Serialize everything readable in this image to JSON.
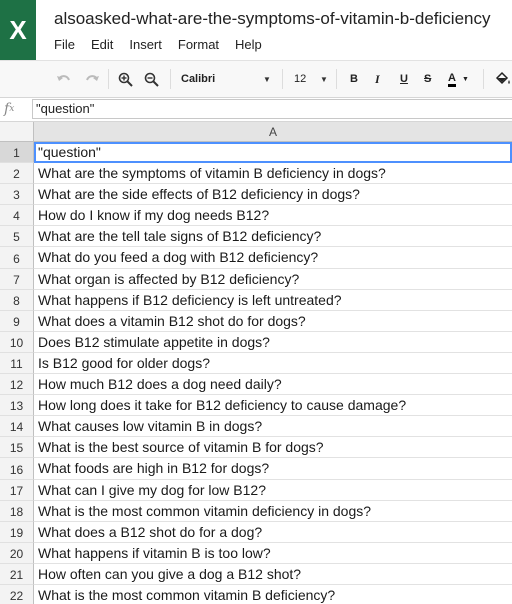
{
  "app": {
    "logo_letter": "X",
    "title": "alsoasked-what-are-the-symptoms-of-vitamin-b-deficiency",
    "accent": "#1e7145"
  },
  "menu": [
    "File",
    "Edit",
    "Insert",
    "Format",
    "Help"
  ],
  "toolbar": {
    "undo_icon": "undo-icon",
    "redo_icon": "redo-icon",
    "zoom_in_icon": "zoom-in-icon",
    "zoom_out_icon": "zoom-out-icon",
    "font_name": "Calibri",
    "font_size": "12",
    "bold": "B",
    "italic": "I",
    "underline": "U",
    "strikethrough": "S",
    "text_color": "A",
    "fill_icon": "paint-bucket-icon"
  },
  "formula_bar": {
    "label": "fx",
    "value": "\"question\""
  },
  "sheet": {
    "column_header": "A",
    "row_numbers": [
      "1",
      "2",
      "3",
      "4",
      "5",
      "6",
      "7",
      "8",
      "9",
      "10",
      "11",
      "12",
      "13",
      "14",
      "15",
      "16",
      "17",
      "18",
      "19",
      "20",
      "21",
      "22"
    ],
    "cells": [
      "\"question\"",
      "What are the symptoms of vitamin B deficiency in dogs?",
      "What are the side effects of B12 deficiency in dogs?",
      "How do I know if my dog needs B12?",
      "What are the tell tale signs of B12 deficiency?",
      "What do you feed a dog with B12 deficiency?",
      "What organ is affected by B12 deficiency?",
      "What happens if B12 deficiency is left untreated?",
      "What does a vitamin B12 shot do for dogs?",
      "Does B12 stimulate appetite in dogs?",
      "Is B12 good for older dogs?",
      "How much B12 does a dog need daily?",
      "How long does it take for B12 deficiency to cause damage?",
      "What causes low vitamin B in dogs?",
      "What is the best source of vitamin B for dogs?",
      "What foods are high in B12 for dogs?",
      "What can I give my dog for low B12?",
      "What is the most common vitamin deficiency in dogs?",
      "What does a B12 shot do for a dog?",
      "What happens if vitamin B is too low?",
      "How often can you give a dog a B12 shot?",
      "What is the most common vitamin B deficiency?"
    ]
  }
}
